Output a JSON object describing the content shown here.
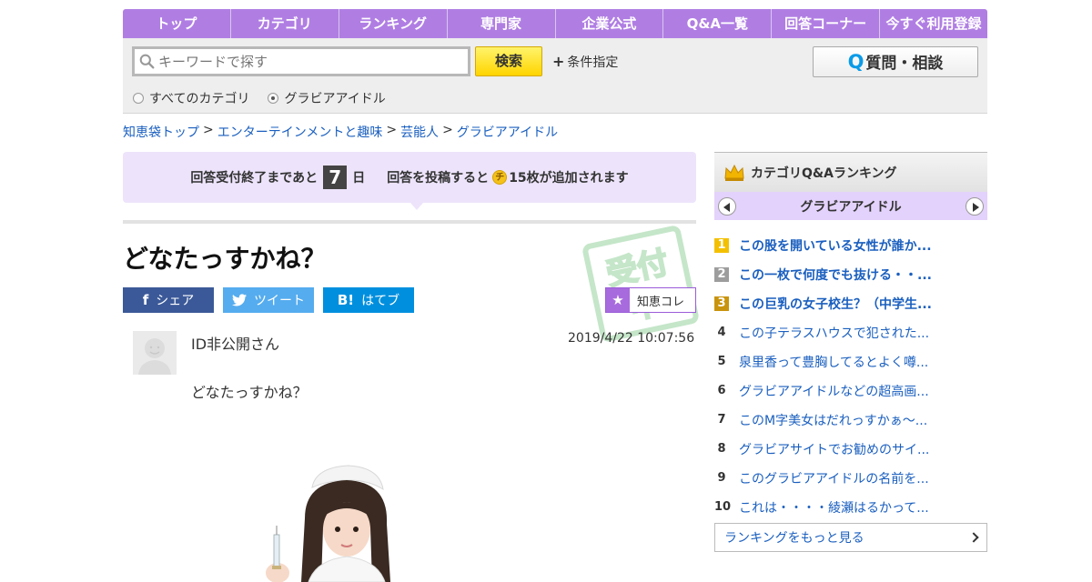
{
  "nav": [
    "トップ",
    "カテゴリ",
    "ランキング",
    "専門家",
    "企業公式",
    "Q&A一覧",
    "回答コーナー",
    "今すぐ利用登録"
  ],
  "search": {
    "placeholder": "キーワードで探す",
    "button": "検索",
    "conditions": "条件指定",
    "ask_button": "質問・相談",
    "radio_all": "すべてのカテゴリ",
    "radio_category": "グラビアアイドル",
    "selected": "グラビアアイドル"
  },
  "breadcrumb": [
    {
      "label": "知恵袋トップ",
      "sep": ""
    },
    {
      "label": "エンターテインメントと趣味",
      "sep": ">"
    },
    {
      "label": "芸能人",
      "sep": ">"
    },
    {
      "label": "グラビアアイドル",
      "sep": ">"
    }
  ],
  "notice": {
    "prefix": "回答受付終了まであと",
    "days": "7",
    "days_unit": "日",
    "middle": "回答を投稿すると",
    "coin": "チ",
    "suffix": "15枚が追加されます"
  },
  "stamp": {
    "text": "受付中"
  },
  "question": {
    "title": "どなたっすかね？",
    "user": "ID非公開さん",
    "time": "2019/4/22 10:07:56",
    "body": "どなたっすかね？"
  },
  "share": {
    "facebook": "シェア",
    "twitter": "ツイート",
    "hatena": "はてブ",
    "chie_kore": "知恵コレ"
  },
  "sidebar": {
    "title": "カテゴリQ&Aランキング",
    "category": "グラビアアイドル",
    "more": "ランキングをもっと見る",
    "ranking": [
      {
        "rank": "1",
        "title": "この股を開いている女性が誰か..."
      },
      {
        "rank": "2",
        "title": "この一枚で何度でも抜ける・・..."
      },
      {
        "rank": "3",
        "title": "この巨乳の女子校生？（中学生..."
      },
      {
        "rank": "4",
        "title": "この子テラスハウスで犯された..."
      },
      {
        "rank": "5",
        "title": "泉里香って豊胸してるとよく噂..."
      },
      {
        "rank": "6",
        "title": "グラビアアイドルなどの超高画..."
      },
      {
        "rank": "7",
        "title": "このM字美女はだれっすかぁ～..."
      },
      {
        "rank": "8",
        "title": "グラビアサイトでお勧めのサイ..."
      },
      {
        "rank": "9",
        "title": "このグラビアアイドルの名前を..."
      },
      {
        "rank": "10",
        "title": "これは・・・・綾瀬はるかって..."
      }
    ]
  },
  "colors": {
    "nav_bg": "#b07ee3",
    "accent_purple": "#ede4fb",
    "link": "#1a5fbf",
    "search_button": "#ffd500"
  }
}
